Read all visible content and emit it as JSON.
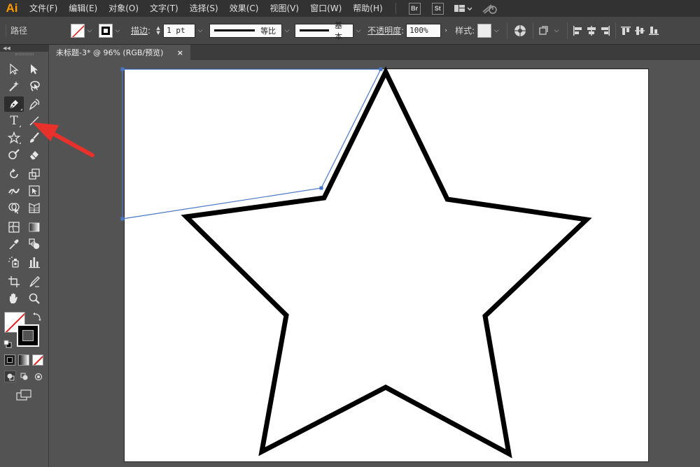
{
  "app": {
    "logo": "Ai",
    "accent_color": "#ff9a00"
  },
  "menu": [
    "文件(F)",
    "编辑(E)",
    "对象(O)",
    "文字(T)",
    "选择(S)",
    "效果(C)",
    "视图(V)",
    "窗口(W)",
    "帮助(H)"
  ],
  "menubar_buttons": {
    "bridge": "Br",
    "stock": "St"
  },
  "control": {
    "selection_type": "路径",
    "stroke_label": "描边",
    "stroke_weight": "1 pt",
    "profile_label": "等比",
    "brush_label": "基本",
    "opacity_label": "不透明度",
    "opacity_value": "100%",
    "style_label": "样式"
  },
  "tab": {
    "title": "未标题-3* @ 96% (RGB/预览)",
    "close": "×"
  },
  "tools": {
    "type_glyph": "T"
  },
  "colors": {
    "path_selection": "#4a78c8",
    "arrow": "#e8312a",
    "artboard": "#ffffff",
    "ui_dark": "#323232",
    "ui_panel": "#535353"
  }
}
